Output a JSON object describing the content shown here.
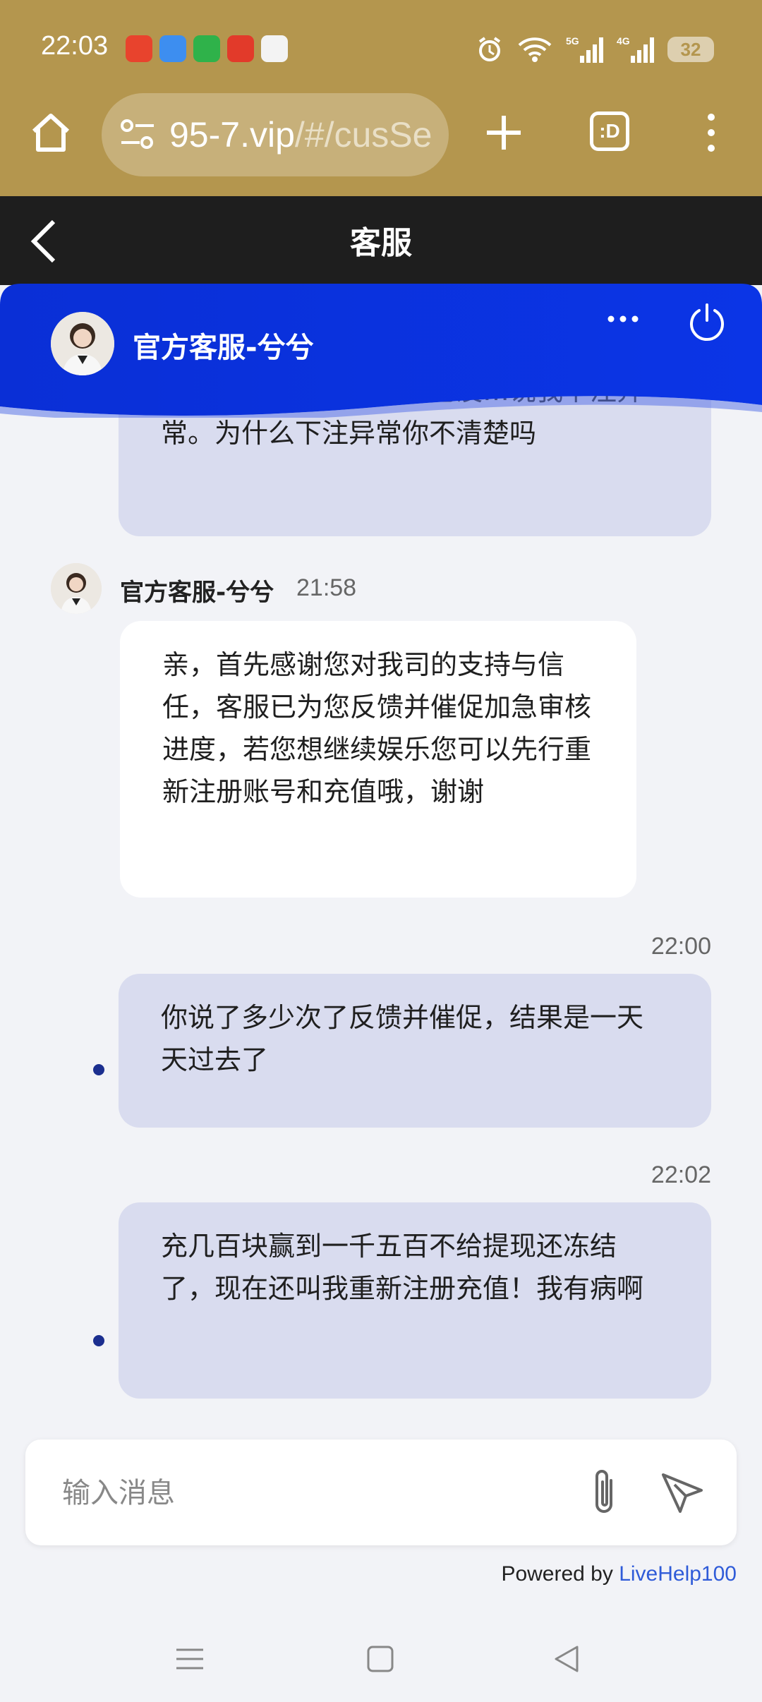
{
  "status_bar": {
    "time": "22:03",
    "battery": "32",
    "network_labels": [
      "5G",
      "4G"
    ]
  },
  "browser": {
    "url_main": "95-7.vip",
    "url_rest": "/#/cusSe",
    "tabs_label": ":D"
  },
  "page": {
    "title": "客服"
  },
  "chat": {
    "agent_name": "官方客服-兮兮",
    "messages": [
      {
        "from": "me",
        "text": "赚非法套利了？我下注也没…说我下注异常。为什么下注异常你不清楚吗"
      },
      {
        "from": "agent",
        "sender": "官方客服-兮兮",
        "time": "21:58",
        "text": "亲，首先感谢您对我司的支持与信任，客服已为您反馈并催促加急审核进度，若您想继续娱乐您可以先行重新注册账号和充值哦，谢谢"
      },
      {
        "from": "me",
        "time": "22:00",
        "text": "你说了多少次了反馈并催促，结果是一天天过去了"
      },
      {
        "from": "me",
        "time": "22:02",
        "text": "充几百块赢到一千五百不给提现还冻结了，现在还叫我重新注册充值！我有病啊"
      }
    ]
  },
  "input": {
    "placeholder": "输入消息"
  },
  "footer": {
    "powered_prefix": "Powered by ",
    "powered_brand": "LiveHelp100"
  },
  "colors": {
    "browser_bar": "#b4964e",
    "page_header": "#1e1e1e",
    "chat_header": "#0a2fd6",
    "my_bubble": "#d9dcef",
    "agent_bubble": "#ffffff",
    "brand_link": "#2f5bd8"
  }
}
